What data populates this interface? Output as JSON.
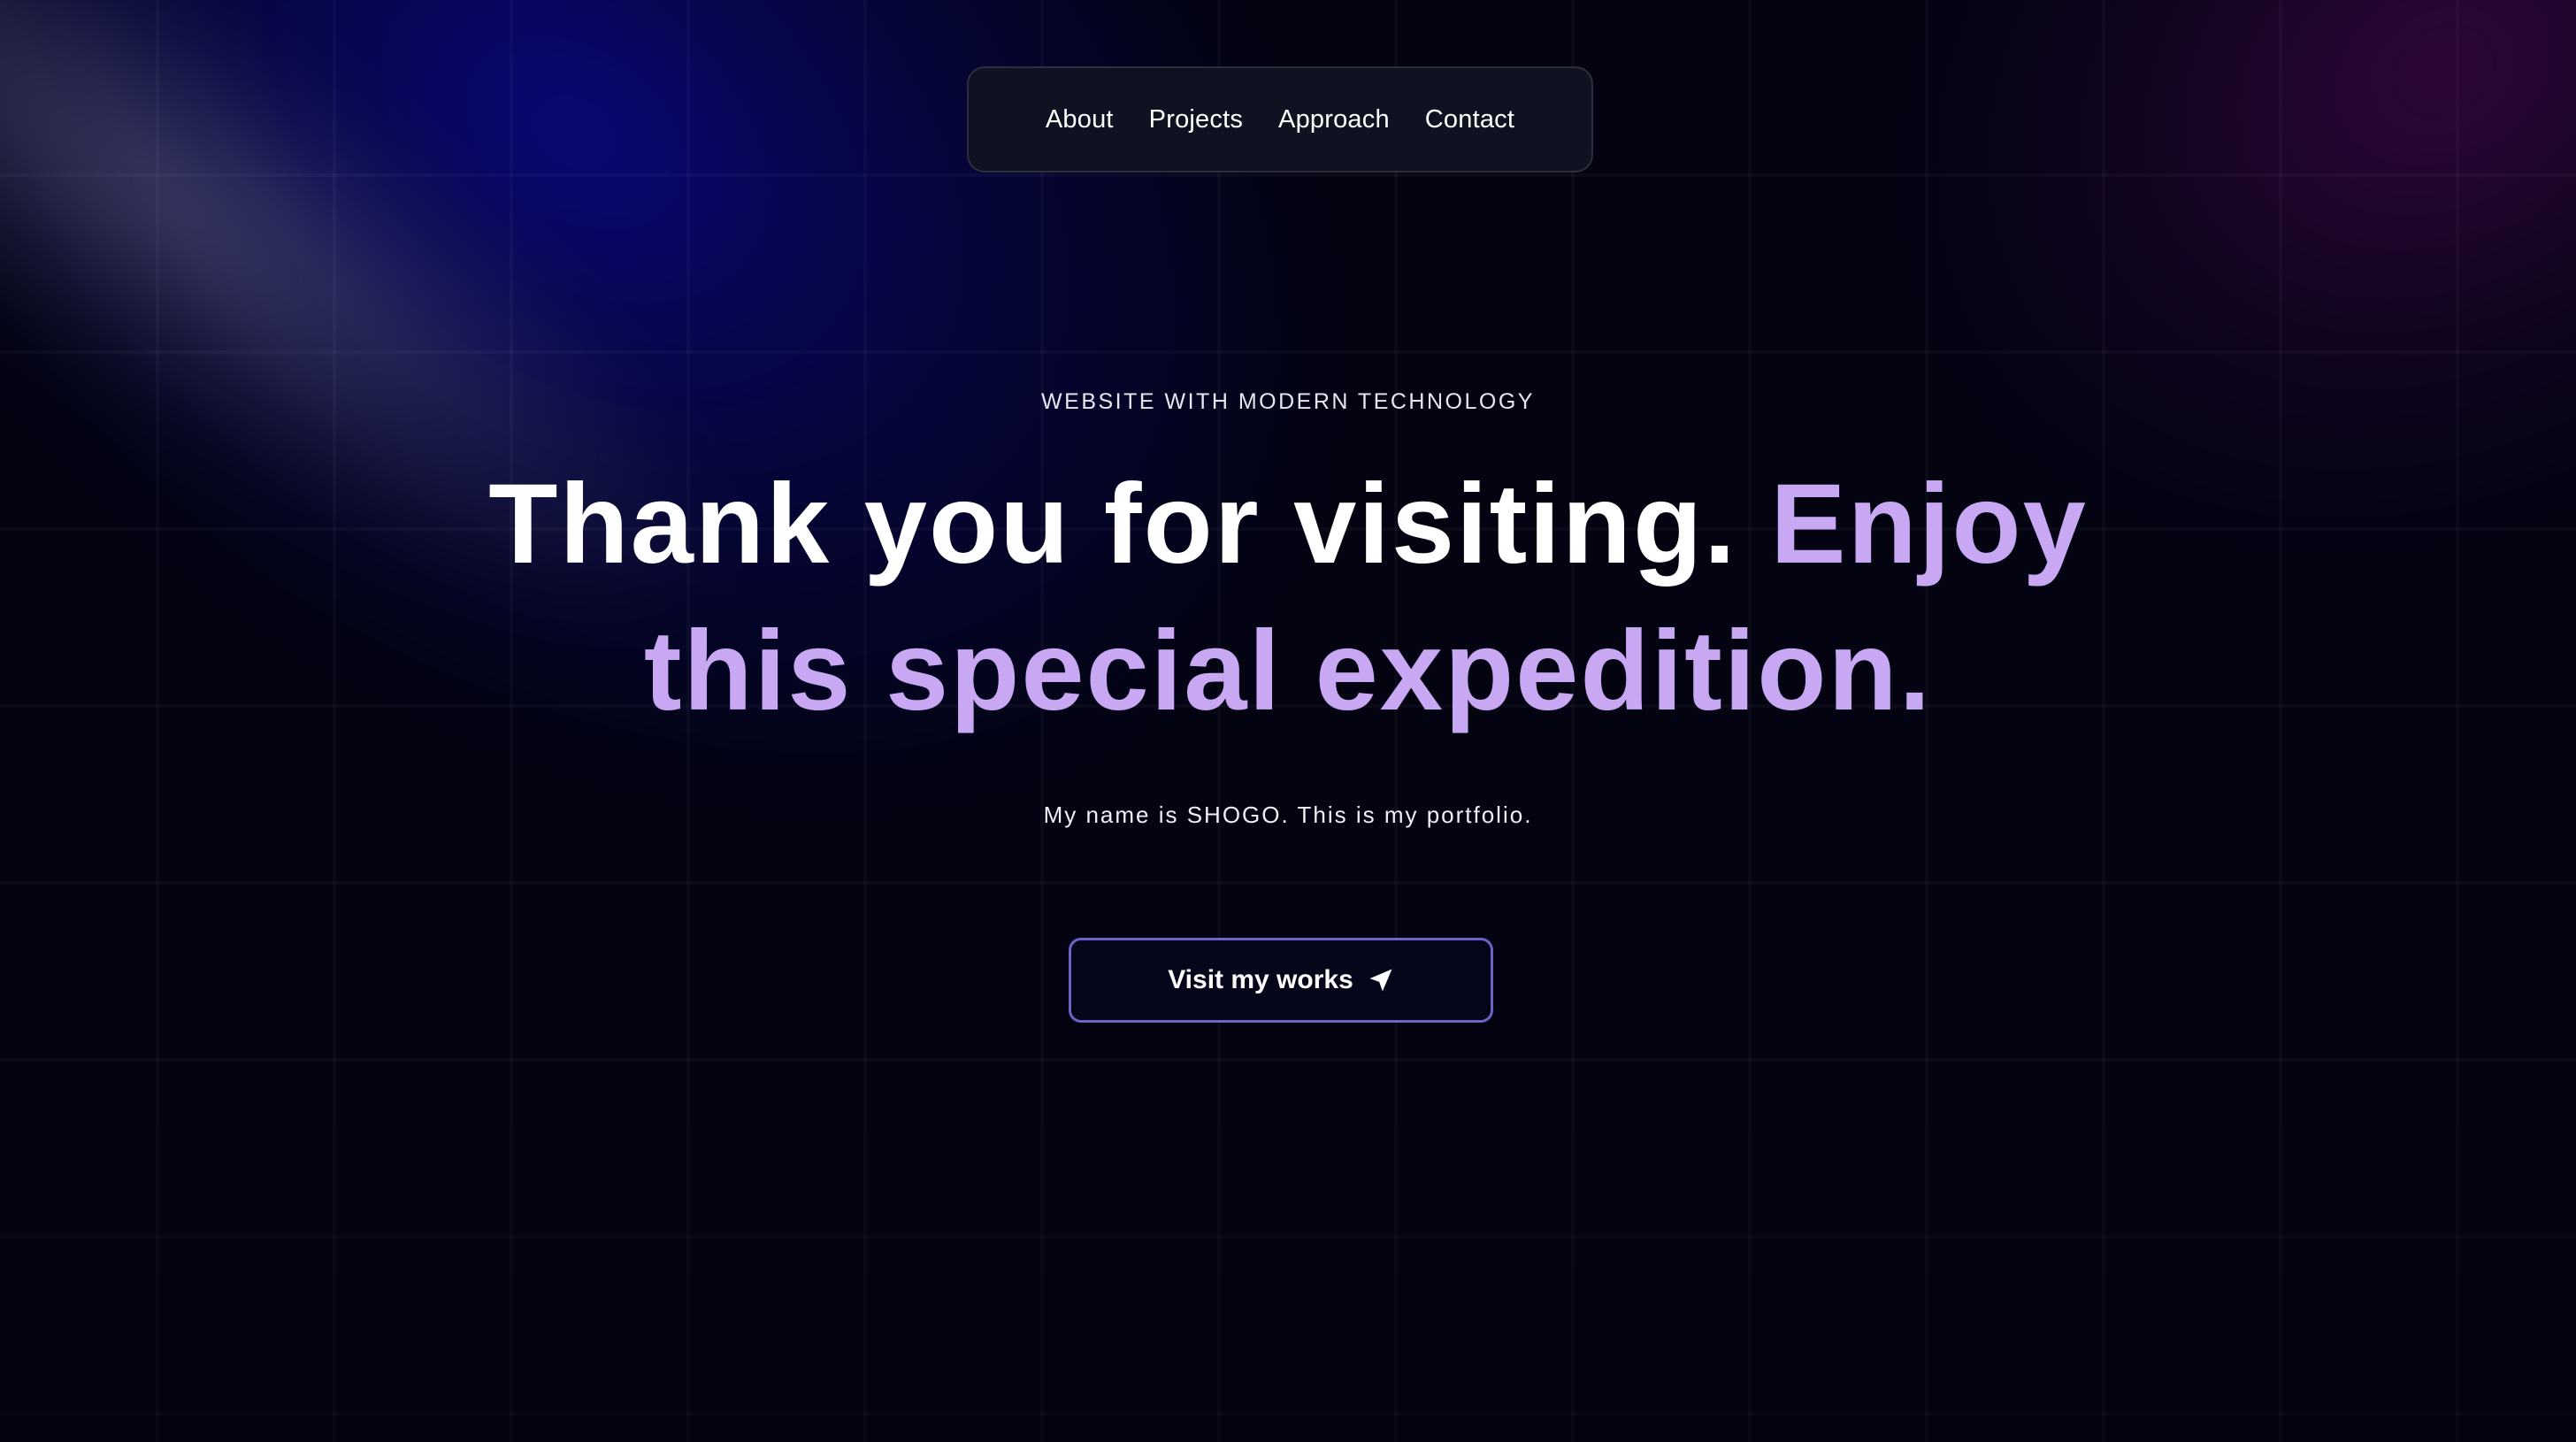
{
  "nav": {
    "items": [
      {
        "label": "About"
      },
      {
        "label": "Projects"
      },
      {
        "label": "Approach"
      },
      {
        "label": "Contact"
      }
    ]
  },
  "hero": {
    "eyebrow": "WEBSITE WITH MODERN TECHNOLOGY",
    "headline_white": "Thank you for visiting.",
    "headline_accent": "Enjoy this special expedition.",
    "subtitle": "My name is SHOGO. This is my portfolio.",
    "cta_label": "Visit my works",
    "cta_icon": "send-icon"
  },
  "colors": {
    "background": "#030312",
    "accent_text": "#c9a8f3",
    "button_border": "#6c63c9"
  }
}
